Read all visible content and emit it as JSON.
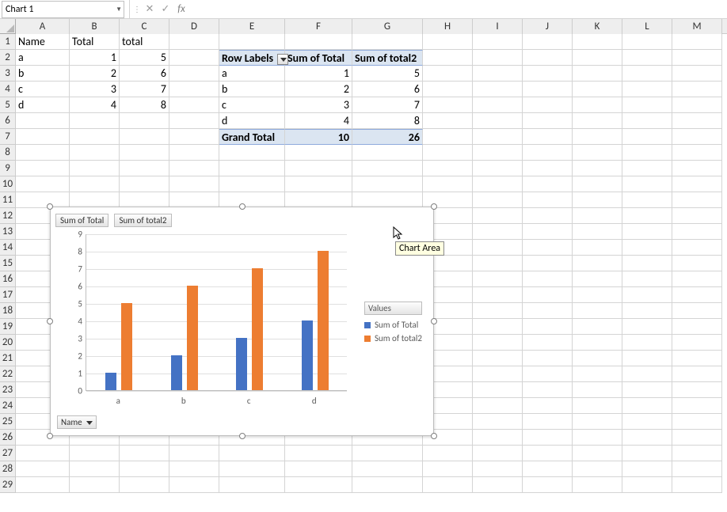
{
  "nameBox": "Chart 1",
  "fbButtons": {
    "cancel": "✕",
    "confirm": "✓",
    "fx": "fx"
  },
  "columns": [
    "A",
    "B",
    "C",
    "D",
    "E",
    "F",
    "G",
    "H",
    "I",
    "J",
    "K",
    "L",
    "M"
  ],
  "rowCount": 29,
  "dataTable": {
    "headers": [
      "Name",
      "Total",
      "total"
    ],
    "rows": [
      {
        "name": "a",
        "total": 1,
        "total2": 5
      },
      {
        "name": "b",
        "total": 2,
        "total2": 6
      },
      {
        "name": "c",
        "total": 3,
        "total2": 7
      },
      {
        "name": "d",
        "total": 4,
        "total2": 8
      }
    ]
  },
  "pivotTable": {
    "rowLabelsHeader": "Row Labels",
    "col1": "Sum of Total",
    "col2": "Sum of total2",
    "rows": [
      {
        "label": "a",
        "v1": 1,
        "v2": 5
      },
      {
        "label": "b",
        "v1": 2,
        "v2": 6
      },
      {
        "label": "c",
        "v1": 3,
        "v2": 7
      },
      {
        "label": "d",
        "v1": 4,
        "v2": 8
      }
    ],
    "grandTotalLabel": "Grand Total",
    "grandTotal1": 10,
    "grandTotal2": 26
  },
  "chart": {
    "fieldButtons": [
      "Sum of Total",
      "Sum of total2"
    ],
    "nameFilter": "Name",
    "legendTitle": "Values",
    "legendItems": [
      "Sum of Total",
      "Sum of total2"
    ],
    "tooltip": "Chart Area"
  },
  "chart_data": {
    "type": "bar",
    "categories": [
      "a",
      "b",
      "c",
      "d"
    ],
    "series": [
      {
        "name": "Sum of Total",
        "values": [
          1,
          2,
          3,
          4
        ],
        "color": "#4472c4"
      },
      {
        "name": "Sum of total2",
        "values": [
          5,
          6,
          7,
          8
        ],
        "color": "#ed7d31"
      }
    ],
    "ylim": [
      0,
      9
    ],
    "yticks": [
      0,
      1,
      2,
      3,
      4,
      5,
      6,
      7,
      8,
      9
    ],
    "xlabel": "",
    "ylabel": "",
    "title": ""
  }
}
